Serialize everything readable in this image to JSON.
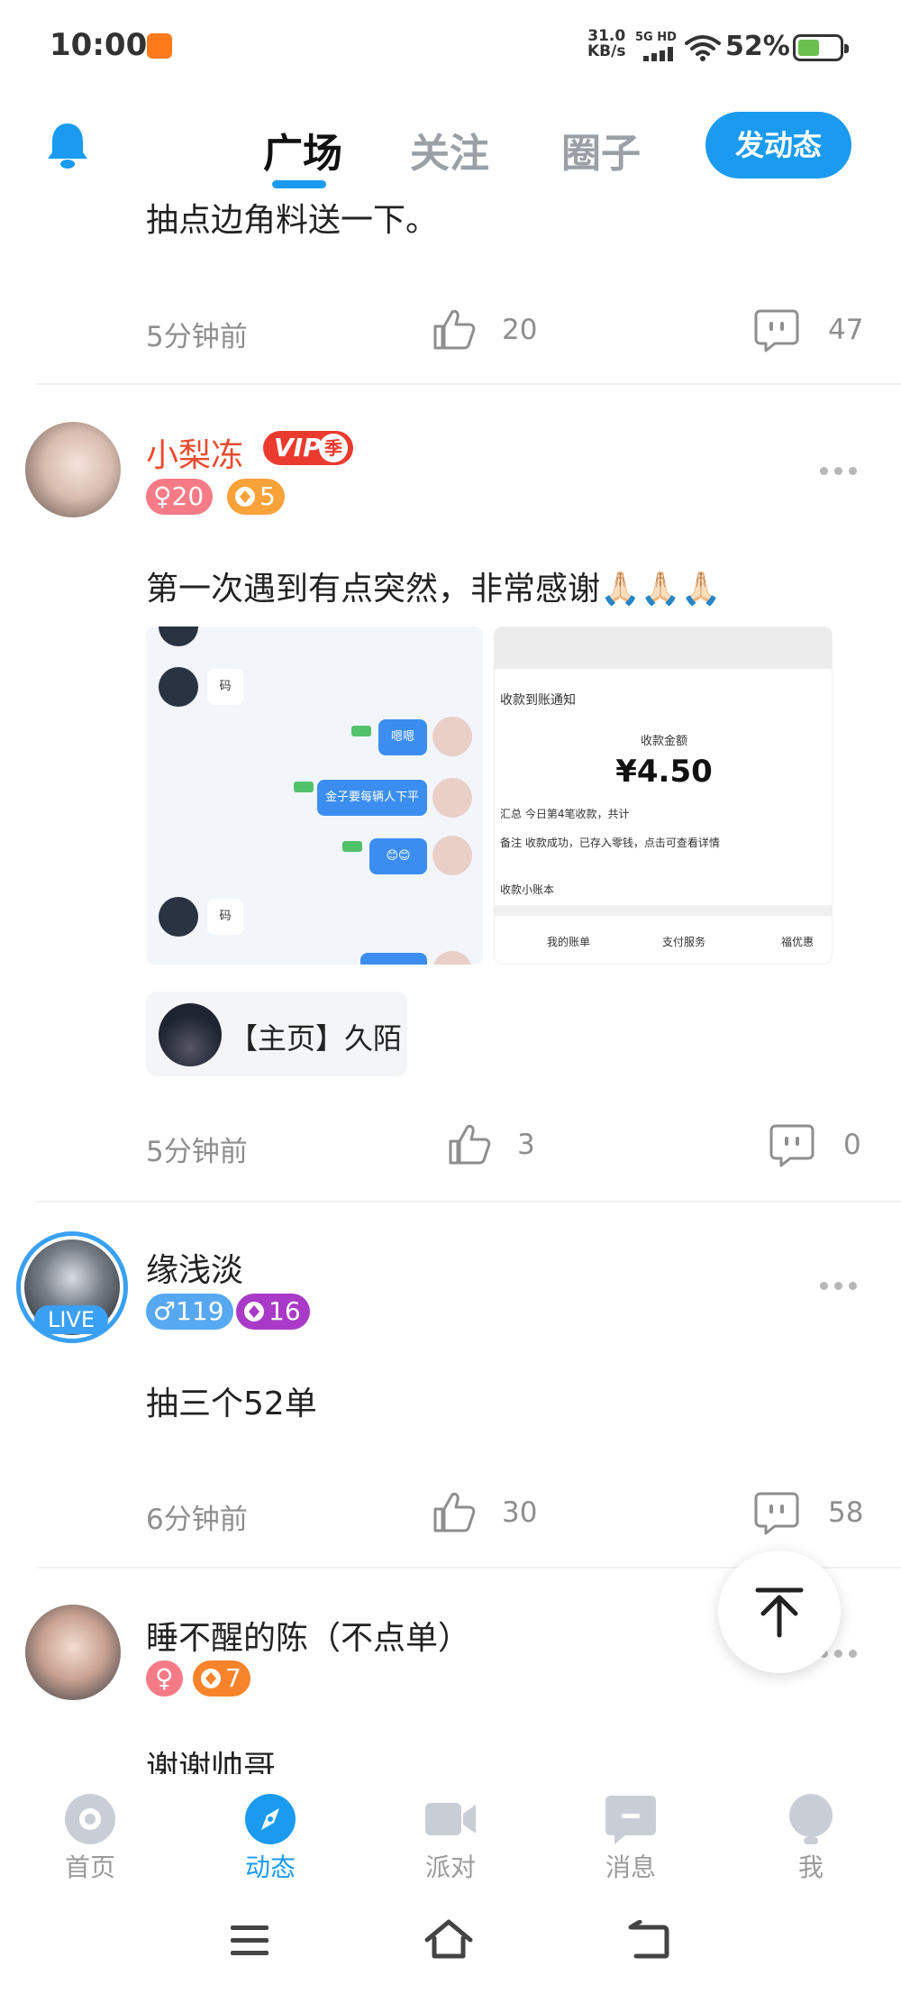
{
  "status_bar": {
    "time": "10:00",
    "speed_value": "31.0",
    "speed_unit": "KB/s",
    "network": "5G HD",
    "battery": "52%",
    "battery_level": 0.52
  },
  "header": {
    "tabs": [
      "广场",
      "关注",
      "圈子"
    ],
    "active_tab": "广场",
    "post_button": "发动态",
    "accent_color": "#1a9bf0"
  },
  "posts": [
    {
      "text": "抽点边角料送一下。",
      "time": "5分钟前",
      "likes": "20",
      "comments": "47"
    },
    {
      "username": "小梨冻",
      "vip_label": "VIP",
      "vip_season": "季",
      "gender_badge": "♀20",
      "gold_badge": "5",
      "text": "第一次遇到有点突然，非常感谢🙏🏻🙏🏻🙏🏻",
      "chat_screenshot": {
        "messages": [
          "嗯嗯",
          "码",
          "嗯嗯",
          "金子要每辆人下平",
          "😊😊",
          "码"
        ]
      },
      "pay_screenshot": {
        "notice": "收款到账通知",
        "total_label": "收款金额",
        "amount": "¥4.50",
        "summary": "汇总  今日第4笔收款，共计",
        "remark": "备注  收款成功，已存入零钱，点击可查看详情",
        "book": "收款小账本",
        "footer": [
          "我的账单",
          "支付服务",
          "福优惠"
        ]
      },
      "link_card": "【主页】久陌",
      "time": "5分钟前",
      "likes": "3",
      "comments": "0"
    },
    {
      "username": "缘浅淡",
      "live_label": "LIVE",
      "gender_badge": "♂119",
      "level_badge": "16",
      "text": "抽三个52单",
      "time": "6分钟前",
      "likes": "30",
      "comments": "58"
    },
    {
      "username": "睡不醒的陈（不点单）",
      "gender_badge": "♀",
      "gold_badge": "7",
      "text": "谢谢帅哥"
    }
  ],
  "bottom_nav": {
    "items": [
      "首页",
      "动态",
      "派对",
      "消息",
      "我"
    ],
    "active": "动态"
  }
}
